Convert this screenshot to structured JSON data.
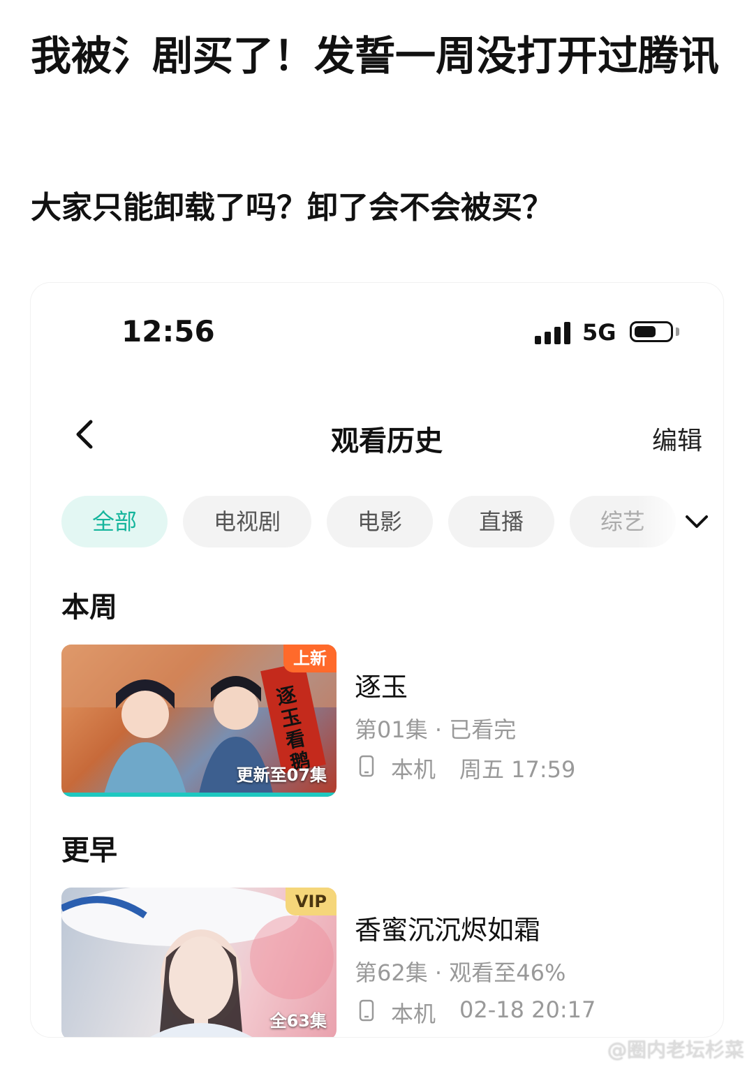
{
  "post": {
    "title": "我被氵剧买了！发誓一周没打开过腾讯",
    "body": "大家只能卸载了吗？卸了会不会被买？"
  },
  "status_bar": {
    "time": "12:56",
    "network": "5G",
    "battery_fraction": 0.6
  },
  "header": {
    "title": "观看历史",
    "edit_label": "编辑"
  },
  "tabs": [
    {
      "label": "全部",
      "active": true
    },
    {
      "label": "电视剧",
      "active": false
    },
    {
      "label": "电影",
      "active": false
    },
    {
      "label": "直播",
      "active": false
    },
    {
      "label": "综艺",
      "active": false
    }
  ],
  "sections": [
    {
      "label": "本周",
      "items": [
        {
          "title": "逐玉",
          "episode": "第01集 · 已看完",
          "device": "本机",
          "time": "周五 17:59",
          "badge": "上新",
          "badge_color": "#ff6a2b",
          "episode_count": "更新至07集",
          "poster_text": "逐玉看鹅",
          "progress": 1.0
        }
      ]
    },
    {
      "label": "更早",
      "items": [
        {
          "title": "香蜜沉沉烬如霜",
          "episode": "第62集 · 观看至46%",
          "device": "本机",
          "time": "02-18 20:17",
          "badge": "VIP",
          "badge_color": "#f5d67a",
          "episode_count": "全63集",
          "progress": 0.46
        }
      ]
    }
  ],
  "watermark": "@圈内老坛杉菜"
}
